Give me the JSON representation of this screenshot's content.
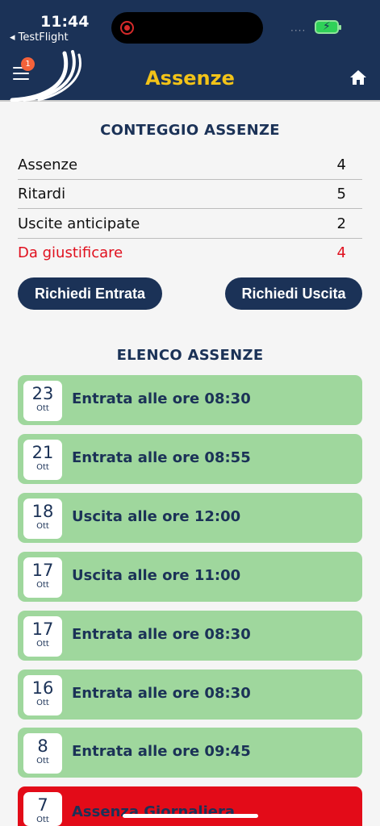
{
  "status": {
    "time": "11:44",
    "back_app": "◂ TestFlight",
    "signal": "····"
  },
  "header": {
    "title": "Assenze",
    "menu_badge": "1",
    "colors": {
      "bar": "#1b3257",
      "title": "#f2c318"
    }
  },
  "counts": {
    "title": "CONTEGGIO ASSENZE",
    "rows": [
      {
        "label": "Assenze",
        "value": "4"
      },
      {
        "label": "Ritardi",
        "value": "5"
      },
      {
        "label": "Uscite anticipate",
        "value": "2"
      },
      {
        "label": "Da giustificare",
        "value": "4"
      }
    ]
  },
  "actions": {
    "entrata": "Richiedi Entrata",
    "uscita": "Richiedi Uscita"
  },
  "list": {
    "title": "ELENCO ASSENZE",
    "items": [
      {
        "day": "23",
        "month": "Ott",
        "text": "Entrata alle ore 08:30"
      },
      {
        "day": "21",
        "month": "Ott",
        "text": "Entrata alle ore 08:55"
      },
      {
        "day": "18",
        "month": "Ott",
        "text": "Uscita alle ore 12:00"
      },
      {
        "day": "17",
        "month": "Ott",
        "text": "Uscita alle ore 11:00"
      },
      {
        "day": "17",
        "month": "Ott",
        "text": "Entrata alle ore 08:30"
      },
      {
        "day": "16",
        "month": "Ott",
        "text": "Entrata alle ore 08:30"
      },
      {
        "day": "8",
        "month": "Ott",
        "text": "Entrata alle ore 09:45"
      },
      {
        "day": "7",
        "month": "Ott",
        "text": "Assenza Giornaliera"
      }
    ],
    "colors": {
      "approved": "#9fd79d",
      "unjustified": "#e30b18"
    }
  }
}
